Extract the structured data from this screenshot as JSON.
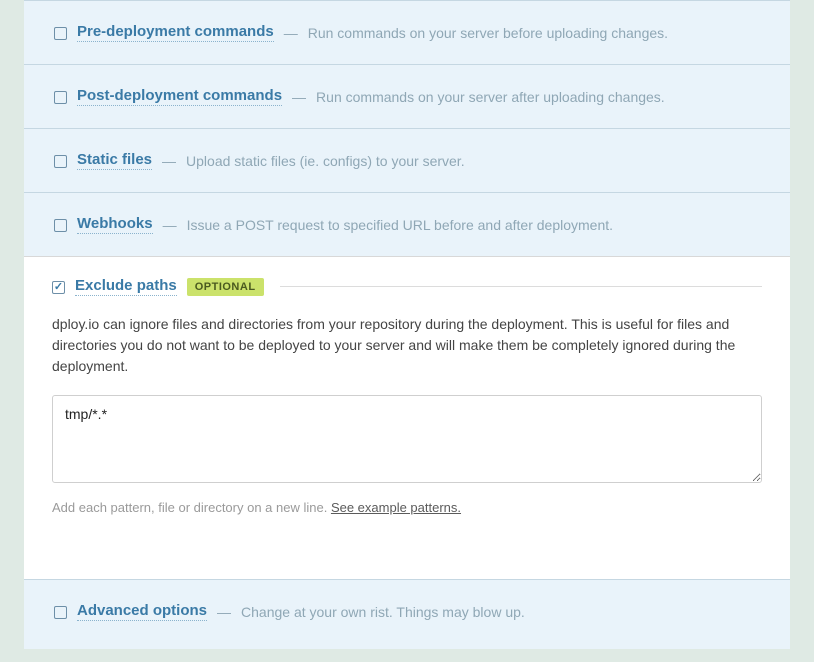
{
  "sections": {
    "pre": {
      "title": "Pre-deployment commands",
      "desc": "Run commands on your server before uploading changes.",
      "checked": false
    },
    "post": {
      "title": "Post-deployment commands",
      "desc": "Run commands on your server after uploading changes.",
      "checked": false
    },
    "static": {
      "title": "Static files",
      "desc": "Upload static files (ie. configs) to your server.",
      "checked": false
    },
    "webhooks": {
      "title": "Webhooks",
      "desc": "Issue a POST request to specified URL before and after deployment.",
      "checked": false
    },
    "exclude": {
      "title": "Exclude paths",
      "badge": "OPTIONAL",
      "body": "dploy.io can ignore files and directories from your repository during the deployment. This is useful for files and directories you do not want to be deployed to your server and will make them be completely ignored during the deployment.",
      "textarea_value": "tmp/*.*",
      "help_prefix": "Add each pattern, file or directory on a new line. ",
      "help_link": "See example patterns.",
      "checked": true
    },
    "advanced": {
      "title": "Advanced options",
      "desc": "Change at your own rist. Things may blow up.",
      "checked": false
    }
  },
  "sep": "—"
}
